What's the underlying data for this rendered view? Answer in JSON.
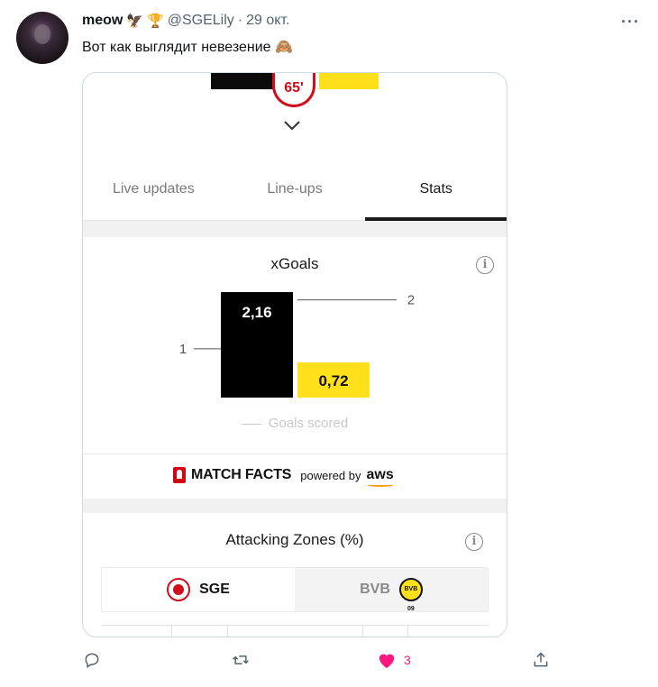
{
  "tweet": {
    "author_name": "meow",
    "badges": [
      "🦅",
      "🏆"
    ],
    "handle": "@SGELily",
    "separator": "·",
    "date": "29 окт.",
    "more": "···",
    "text": "Вот как выглядит невезение",
    "emoji": "🙈"
  },
  "match": {
    "minute": "65'",
    "tabs": [
      {
        "label": "Live updates",
        "active": false
      },
      {
        "label": "Line-ups",
        "active": false
      },
      {
        "label": "Stats",
        "active": true
      }
    ]
  },
  "xgoals": {
    "title": "xGoals",
    "info_icon": "i",
    "legend": "Goals scored"
  },
  "chart_data": {
    "type": "bar",
    "title": "xGoals",
    "categories": [
      "SGE",
      "BVB"
    ],
    "series": [
      {
        "values": [
          2.16,
          0.72
        ]
      },
      {
        "name": "Goals scored",
        "values": [
          1,
          2
        ]
      }
    ],
    "data_labels": [
      "2,16",
      "0,72"
    ],
    "goals_labels": [
      "1",
      "2"
    ],
    "colors": [
      "#000000",
      "#ffe01b"
    ],
    "ylim": [
      0,
      2.4
    ],
    "grid": false
  },
  "match_facts": {
    "brand": "MATCH FACTS",
    "powered_by": "powered by",
    "partner": "aws"
  },
  "attacking_zones": {
    "title": "Attacking Zones (%)",
    "info_icon": "i",
    "teams": [
      {
        "label": "SGE",
        "active": true
      },
      {
        "label": "BVB",
        "active": false,
        "crest_text": "BVB 09"
      }
    ]
  },
  "actions": {
    "reply_count": "",
    "retweet_count": "",
    "like_count": "3",
    "like_color": "#f91880"
  }
}
